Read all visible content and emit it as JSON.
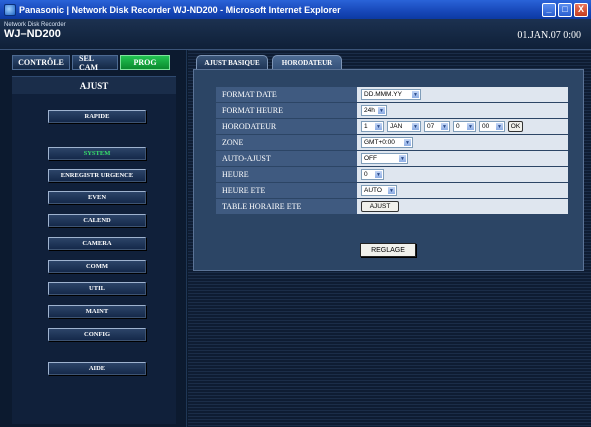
{
  "window": {
    "title": "Panasonic | Network Disk Recorder WJ-ND200 - Microsoft Internet Explorer",
    "controls": {
      "minimize": "_",
      "maximize": "□",
      "close": "X"
    }
  },
  "header": {
    "subtitle": "Network Disk Recorder",
    "model": "WJ–ND200",
    "datetime": "01.JAN.07  0:00"
  },
  "mode_tabs": {
    "controle": "CONTRÔLE",
    "selcam": "SEL CAM",
    "prog": "PROG"
  },
  "sidebar": {
    "title": "AJUST",
    "items": {
      "rapide": "RAPIDE",
      "system": "SYSTEM",
      "enregistr": "ENREGISTR URGENCE",
      "even": "EVEN",
      "calend": "CALEND",
      "camera": "CAMERA",
      "comm": "COMM",
      "util": "UTIL",
      "maint": "MAINT",
      "config": "CONFIG",
      "aide": "AIDE"
    },
    "selected": "SYSTEM"
  },
  "tabs": {
    "basic": "AJUST BASIQUE",
    "horodateur": "HORODATEUR"
  },
  "settings": {
    "format_date": {
      "label": "FORMAT DATE",
      "value": "DD.MMM.YY"
    },
    "format_heure": {
      "label": "FORMAT HEURE",
      "value": "24h"
    },
    "horodateur": {
      "label": "HORODATEUR",
      "day": "1",
      "month": "JAN",
      "year": "07",
      "hour": "0",
      "minute": "00",
      "ok": "OK"
    },
    "zone": {
      "label": "ZONE",
      "value": "GMT+0:00"
    },
    "auto_ajust": {
      "label": "AUTO-AJUST",
      "value": "OFF"
    },
    "heure": {
      "label": "HEURE",
      "value": "0"
    },
    "heure_ete": {
      "label": "HEURE ETE",
      "value": "AUTO"
    },
    "table_horaire": {
      "label": "TABLE HORAIRE ETE",
      "button": "AJUST"
    }
  },
  "actions": {
    "reglage": "REGLAGE"
  },
  "icons": {
    "dropdown": "▼"
  },
  "colors": {
    "accent_green": "#22c452",
    "selected_text": "#37e06a"
  }
}
